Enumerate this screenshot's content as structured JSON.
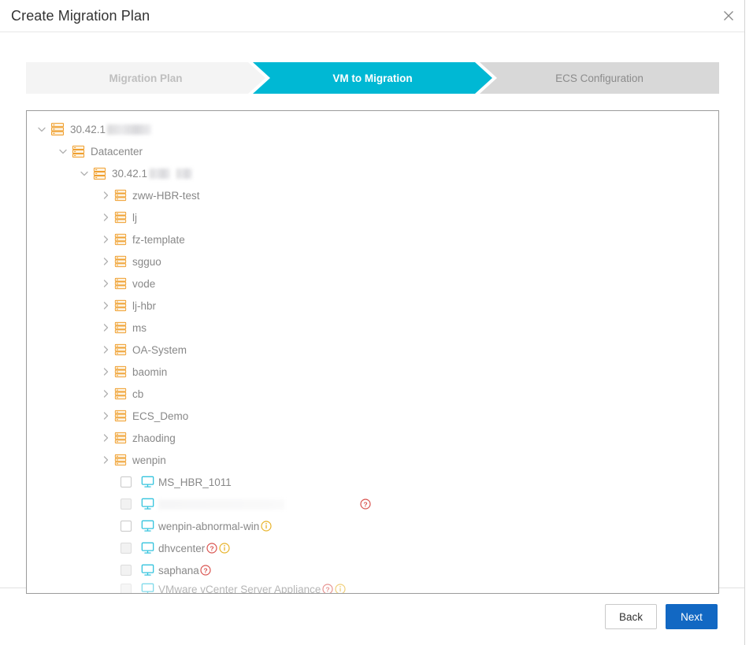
{
  "window": {
    "title": "Create Migration Plan",
    "close_icon": "close-icon"
  },
  "colors": {
    "active_step": "#00b8d4",
    "inactive_step": "#f4f4f4",
    "pending_step": "#d8d8d8",
    "primary_button": "#1268c3",
    "rack_icon": "#f0a030",
    "monitor_icon": "#35c4de",
    "warn_badge": "#d9534f",
    "info_badge": "#e8b32a"
  },
  "steps": [
    {
      "label": "Migration Plan",
      "state": "done"
    },
    {
      "label": "VM to Migration",
      "state": "active"
    },
    {
      "label": "ECS Configuration",
      "state": "pending"
    }
  ],
  "tree": {
    "nodes": [
      {
        "id": "root",
        "type": "rack",
        "depth": 0,
        "expanded": true,
        "label": "30.42.1",
        "redacted": "b1"
      },
      {
        "id": "datacenter",
        "type": "rack",
        "depth": 1,
        "expanded": true,
        "label": "Datacenter",
        "redacted": ""
      },
      {
        "id": "cluster-ip",
        "type": "rack",
        "depth": 2,
        "expanded": true,
        "label": "30.42.1",
        "redacted": "b2b3"
      },
      {
        "id": "zww-hbr-test",
        "type": "rack",
        "depth": 3,
        "expanded": false,
        "label": "zww-HBR-test",
        "redacted": ""
      },
      {
        "id": "lj",
        "type": "rack",
        "depth": 3,
        "expanded": false,
        "label": "lj",
        "redacted": ""
      },
      {
        "id": "fz-template",
        "type": "rack",
        "depth": 3,
        "expanded": false,
        "label": "fz-template",
        "redacted": ""
      },
      {
        "id": "sgguo",
        "type": "rack",
        "depth": 3,
        "expanded": false,
        "label": "sgguo",
        "redacted": ""
      },
      {
        "id": "vode",
        "type": "rack",
        "depth": 3,
        "expanded": false,
        "label": "vode",
        "redacted": ""
      },
      {
        "id": "lj-hbr",
        "type": "rack",
        "depth": 3,
        "expanded": false,
        "label": "lj-hbr",
        "redacted": ""
      },
      {
        "id": "ms",
        "type": "rack",
        "depth": 3,
        "expanded": false,
        "label": "ms",
        "redacted": ""
      },
      {
        "id": "oa-system",
        "type": "rack",
        "depth": 3,
        "expanded": false,
        "label": "OA-System",
        "redacted": ""
      },
      {
        "id": "baomin",
        "type": "rack",
        "depth": 3,
        "expanded": false,
        "label": "baomin",
        "redacted": ""
      },
      {
        "id": "cb",
        "type": "rack",
        "depth": 3,
        "expanded": false,
        "label": "cb",
        "redacted": ""
      },
      {
        "id": "ecs-demo",
        "type": "rack",
        "depth": 3,
        "expanded": false,
        "label": "ECS_Demo",
        "redacted": ""
      },
      {
        "id": "zhaoding",
        "type": "rack",
        "depth": 3,
        "expanded": false,
        "label": "zhaoding",
        "redacted": ""
      },
      {
        "id": "wenpin",
        "type": "rack",
        "depth": 3,
        "expanded": false,
        "label": "wenpin",
        "redacted": ""
      }
    ],
    "vms": [
      {
        "id": "ms-hbr-1011",
        "label": "MS_HBR_1011",
        "checkbox": "enabled",
        "checked": false,
        "badges": []
      },
      {
        "id": "vm-redacted",
        "label": "",
        "checkbox": "disabled",
        "checked": false,
        "badges": [
          "warn-far"
        ]
      },
      {
        "id": "wenpin-abn",
        "label": "wenpin-abnormal-win",
        "checkbox": "enabled",
        "checked": false,
        "badges": [
          "info"
        ]
      },
      {
        "id": "dhvcenter",
        "label": "dhvcenter",
        "checkbox": "disabled",
        "checked": false,
        "badges": [
          "warn",
          "info"
        ]
      },
      {
        "id": "saphana",
        "label": "saphana",
        "checkbox": "disabled",
        "checked": false,
        "badges": [
          "warn"
        ]
      },
      {
        "id": "vcsa",
        "label": "VMware vCenter Server Appliance",
        "checkbox": "disabled",
        "checked": false,
        "badges": [
          "warn",
          "info"
        ]
      }
    ]
  },
  "footer": {
    "back_label": "Back",
    "next_label": "Next"
  }
}
